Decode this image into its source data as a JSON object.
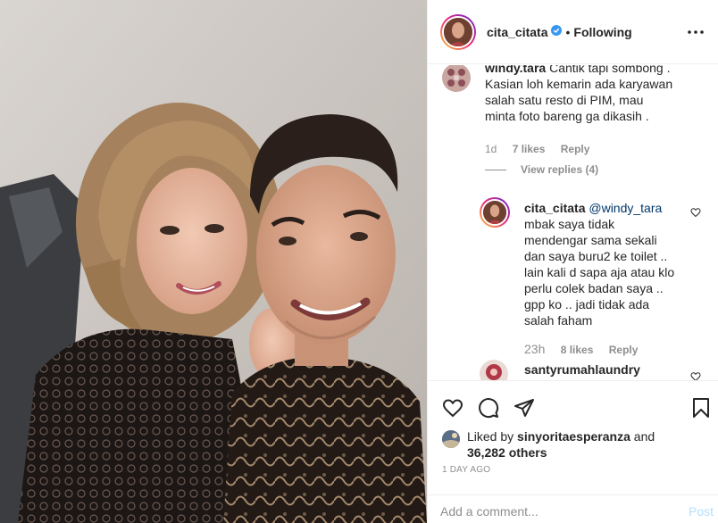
{
  "header": {
    "username": "cita_citata",
    "separator": "•",
    "follow_status": "Following"
  },
  "comments": [
    {
      "username": "windy.tara",
      "text_lines": [
        "Cantik tapi sombong .",
        "Kasian loh kemarin ada karyawan",
        "salah satu resto di PIM, mau",
        "minta foto bareng ga dikasih ."
      ],
      "age": "1d",
      "likes": "7 likes",
      "reply_label": "Reply",
      "view_replies": "View replies (4)"
    },
    {
      "username": "cita_citata",
      "mention": "@windy_tara",
      "text_lines": [
        "mbak saya tidak",
        "mendengar sama sekali",
        "dan saya buru2 ke toilet ..",
        "lain kali d sapa aja atau klo",
        "perlu colek badan saya ..",
        "gpp ko .. jadi tidak ada",
        "salah faham"
      ],
      "age": "23h",
      "likes": "8 likes",
      "reply_label": "Reply"
    },
    {
      "username": "santyrumahlaundry"
    }
  ],
  "likes": {
    "prefix": "Liked by",
    "liker": "sinyoritaesperanza",
    "connector": "and",
    "count": "36,282 others"
  },
  "timestamp": "1 DAY AGO",
  "add_comment": {
    "placeholder": "Add a comment...",
    "post_label": "Post"
  },
  "icons": {
    "heart": "heart-icon",
    "comment": "comment-icon",
    "share": "share-icon",
    "save": "bookmark-icon",
    "more": "more-options-icon",
    "verified": "verified-badge-icon"
  },
  "colors": {
    "verified": "#3897f0",
    "post_disabled": "#b2dffc",
    "meta": "#8e8e8e",
    "mention": "#00376b"
  }
}
